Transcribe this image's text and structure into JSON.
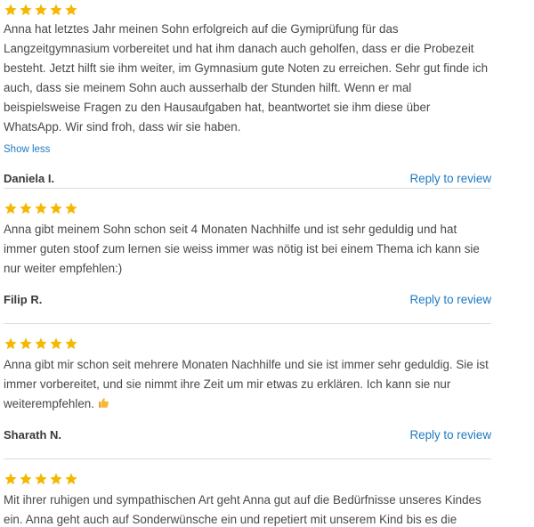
{
  "colors": {
    "star": "#f5b800",
    "link": "#1f7ac2",
    "divider": "#dcdcdc",
    "text": "#484848"
  },
  "reviews": [
    {
      "rating": 5,
      "text": "Anna hat letztes Jahr meinen Sohn erfolgreich auf die Gymiprüfung für das Langzeitgymnasium vorbereitet und hat ihm danach auch geholfen, dass er die Probezeit besteht. Jetzt hilft sie ihm weiter, im Gymnasium gute Noten zu erreichen. Sehr gut finde ich auch, dass sie meinem Sohn auch ausserhalb der Stunden hilft. Wenn er mal beispielsweise Fragen zu den Hausaufgaben hat, beantwortet sie ihm diese über WhatsApp. Wir sind froh, dass wir sie haben.",
      "show_less_label": "Show less",
      "author": "Daniela I.",
      "reply_label": "Reply to review"
    },
    {
      "rating": 5,
      "text": "Anna gibt meinem Sohn schon seit 4 Monaten Nachhilfe und ist sehr geduldig und hat immer guten stoof zum lernen sie weiss immer was nötig ist bei einem Thema ich kann sie nur weiter empfehlen:)",
      "author": "Filip R.",
      "reply_label": "Reply to review"
    },
    {
      "rating": 5,
      "text": "Anna gibt mir schon seit mehrere Monaten Nachhilfe und sie ist immer sehr geduldig. Sie ist immer vorbereitet, und sie nimmt ihre Zeit um mir etwas zu erklären. Ich kann sie nur weiterempfehlen.",
      "emoji_icon": "thumbs-up-icon",
      "author": "Sharath N.",
      "reply_label": "Reply to review"
    },
    {
      "rating": 5,
      "text": "Mit ihrer ruhigen und sympathischen Art geht Anna gut auf die Bedürfnisse unseres Kindes ein. Anna geht auch auf Sonderwünsche ein und repetiert mit unserem Kind bis es die notwendige Sicherheit erlangt. Vielen Dank Anna"
    }
  ]
}
